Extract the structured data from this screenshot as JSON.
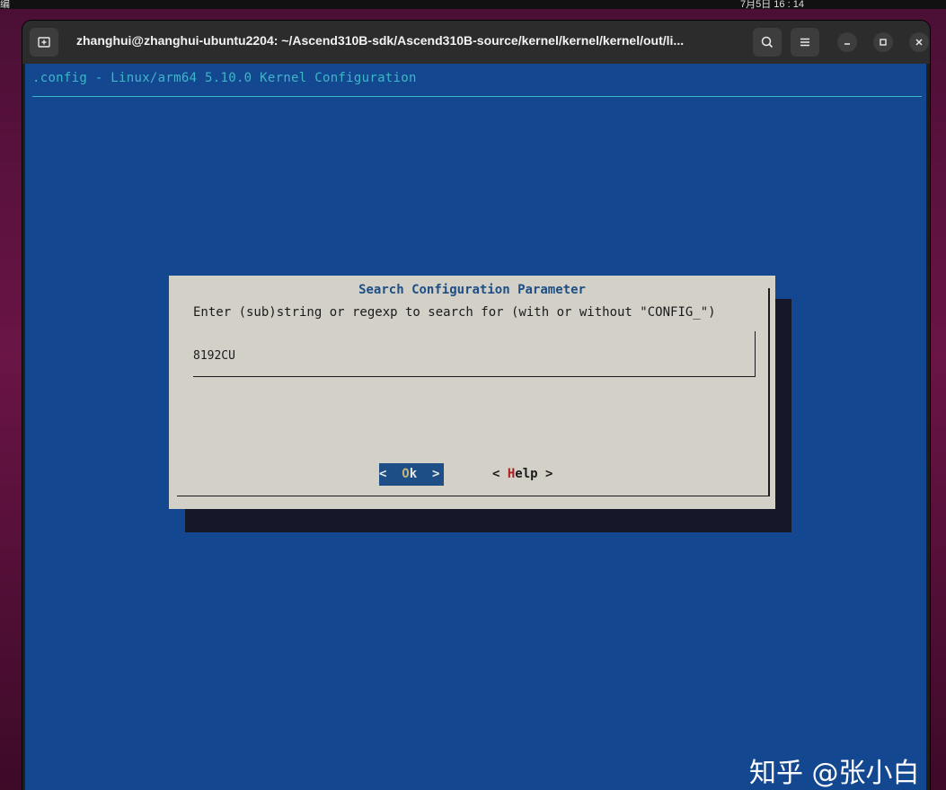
{
  "desktop": {
    "top_left_fragment": "编",
    "clock_fragment": "7月5日 16 : 14"
  },
  "window": {
    "title": "zhanghui@zhanghui-ubuntu2204: ~/Ascend310B-sdk/Ascend310B-source/kernel/kernel/kernel/out/li...",
    "icons": [
      "new-tab-icon",
      "search-icon",
      "menu-icon",
      "minimize-icon",
      "maximize-icon",
      "close-icon"
    ]
  },
  "terminal": {
    "header": ".config - Linux/arm64 5.10.0 Kernel Configuration",
    "colors": {
      "background": "#134890",
      "header": "#3fb5c8",
      "dialog": "#d3d0c8",
      "accent": "#1d4f86"
    }
  },
  "dialog": {
    "title": "Search Configuration Parameter",
    "prompt": "Enter (sub)string or regexp to search for (with or without \"CONFIG_\")",
    "input_value": "8192CU",
    "ok": {
      "left": "<  ",
      "hotkey": "O",
      "rest": "k  >"
    },
    "help": {
      "left": "< ",
      "hotkey": "H",
      "rest": "elp >"
    }
  },
  "watermark": "知乎 @张小白"
}
